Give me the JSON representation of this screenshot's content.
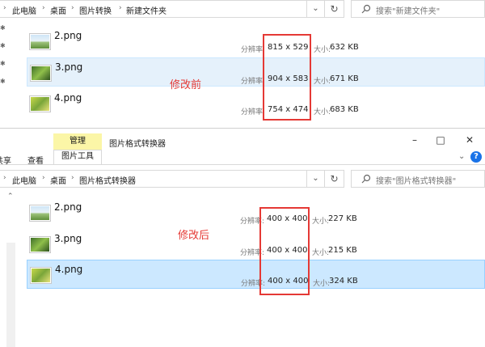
{
  "top_window": {
    "breadcrumb": [
      "此电脑",
      "桌面",
      "图片转换",
      "新建文件夹"
    ],
    "search_placeholder": "搜索\"新建文件夹\"",
    "files": [
      {
        "name": "2.png",
        "res_label": "分辨率:",
        "resolution": "815 x 529",
        "size_label": "大小:",
        "size": "632 KB"
      },
      {
        "name": "3.png",
        "res_label": "分辨率:",
        "resolution": "904 x 583",
        "size_label": "大小:",
        "size": "671 KB"
      },
      {
        "name": "4.png",
        "res_label": "分辨率:",
        "resolution": "754 x 474",
        "size_label": "大小:",
        "size": "683 KB"
      }
    ],
    "annotation": "修改前"
  },
  "bottom_window": {
    "ribbon": {
      "manage_tab": "管理",
      "picture_tools_tab": "图片工具",
      "window_title": "图片格式转换器",
      "share_tab": "共享",
      "view_tab": "查看"
    },
    "breadcrumb": [
      "此电脑",
      "桌面",
      "图片格式转换器"
    ],
    "search_placeholder": "搜索\"图片格式转换器\"",
    "files": [
      {
        "name": "2.png",
        "res_label": "分辨率:",
        "resolution": "400 x 400",
        "size_label": "大小:",
        "size": "227 KB"
      },
      {
        "name": "3.png",
        "res_label": "分辨率:",
        "resolution": "400 x 400",
        "size_label": "大小:",
        "size": "215 KB"
      },
      {
        "name": "4.png",
        "res_label": "分辨率:",
        "resolution": "400 x 400",
        "size_label": "大小:",
        "size": "324 KB"
      }
    ],
    "annotation": "修改后"
  },
  "icons": {
    "chevron": "chevron-down-icon",
    "refresh": "refresh-icon",
    "search": "search-icon",
    "help": "help-icon"
  },
  "colors": {
    "accent_red": "#e53935",
    "selection_light": "#e5f1fb",
    "selection_strong": "#cce8ff",
    "manage_tab": "#fbf6a7",
    "help_blue": "#1a73e8"
  }
}
